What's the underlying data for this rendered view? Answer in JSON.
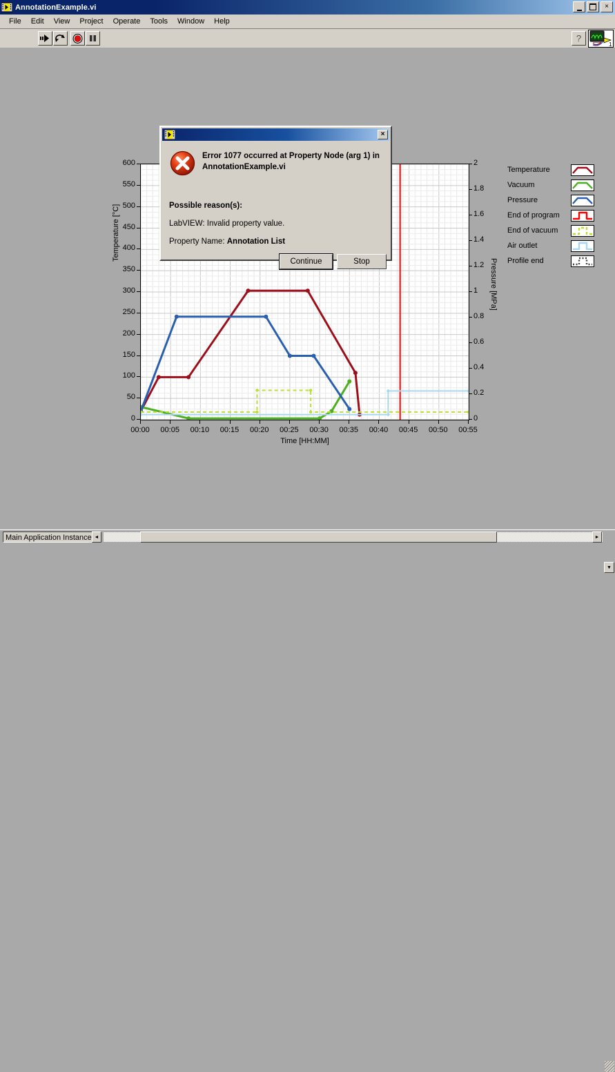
{
  "window": {
    "title": "AnnotationExample.vi",
    "icon": "labview-vi-icon",
    "minimize": "_",
    "maximize": "□",
    "close": "×"
  },
  "menu": {
    "items": [
      {
        "label": "File"
      },
      {
        "label": "Edit"
      },
      {
        "label": "View"
      },
      {
        "label": "Project"
      },
      {
        "label": "Operate"
      },
      {
        "label": "Tools"
      },
      {
        "label": "Window"
      },
      {
        "label": "Help"
      }
    ]
  },
  "toolbar": {
    "run_label": "run-arrow-icon",
    "run_continuous_label": "run-continuously-icon",
    "abort_label": "abort-execution-icon",
    "pause_label": "pause-icon",
    "help_label": "?",
    "vi_icon_label": "vi-connector-pane",
    "vi_icon_number": "1"
  },
  "dialog": {
    "title": "",
    "close_label": "×",
    "error_title": "Error 1077 occurred at Property Node (arg 1) in AnnotationExample.vi",
    "reason_heading": "Possible reason(s):",
    "reason_line": "LabVIEW:  Invalid property value.",
    "property_label": "Property Name: ",
    "property_value": "Annotation List",
    "continue_label": "Continue",
    "stop_label": "Stop",
    "icon": "error-x-icon"
  },
  "graph": {
    "left_axis_title": "Temperature [°C]",
    "right_axis_title": "Pressure [MPa]",
    "x_axis_title": "Time [HH:MM]"
  },
  "legend": {
    "items": [
      {
        "label": "Temperature",
        "color": "#9c0f1a",
        "style": "solid",
        "swatch": "ramp"
      },
      {
        "label": "Vacuum",
        "color": "#4caf20",
        "style": "solid",
        "swatch": "ramp"
      },
      {
        "label": "Pressure",
        "color": "#2a5fb0",
        "style": "solid",
        "swatch": "ramp"
      },
      {
        "label": "End of program",
        "color": "#ff0000",
        "style": "solid",
        "swatch": "step"
      },
      {
        "label": "End of vacuum",
        "color": "#bbe030",
        "style": "dashed",
        "swatch": "step"
      },
      {
        "label": "Air outlet",
        "color": "#a8d8f0",
        "style": "solid",
        "swatch": "step"
      },
      {
        "label": "Profile end",
        "color": "#404040",
        "style": "dotted",
        "swatch": "step"
      }
    ]
  },
  "statusbar": {
    "context": "Main Application Instance",
    "left_arrow": "◄",
    "right_arrow": "►",
    "up_arrow": "▼"
  },
  "chart_data": {
    "type": "line",
    "title": "",
    "xlabel": "Time [HH:MM]",
    "ylabel": "Temperature [°C]",
    "ylabel_right": "Pressure [MPa]",
    "xlim": [
      0,
      55
    ],
    "ylim": [
      0,
      600
    ],
    "ylim_right": [
      0,
      2
    ],
    "grid": true,
    "legend_position": "right-outside",
    "xticks": [
      "00:00",
      "00:05",
      "00:10",
      "00:15",
      "00:20",
      "00:25",
      "00:30",
      "00:35",
      "00:40",
      "00:45",
      "00:50",
      "00:55"
    ],
    "xtick_values": [
      0,
      5,
      10,
      15,
      20,
      25,
      30,
      35,
      40,
      45,
      50,
      55
    ],
    "yticks_left": [
      0,
      50,
      100,
      150,
      200,
      250,
      300,
      350,
      400,
      450,
      500,
      550,
      600
    ],
    "yticks_right": [
      0,
      0.2,
      0.4,
      0.6,
      0.8,
      1,
      1.2,
      1.4,
      1.6,
      1.8,
      2
    ],
    "series": [
      {
        "name": "Temperature",
        "color": "#9c0f1a",
        "axis": "left",
        "style": "solid",
        "width": 3,
        "markers": true,
        "points": [
          [
            0,
            20
          ],
          [
            3,
            100
          ],
          [
            8,
            100
          ],
          [
            18,
            303
          ],
          [
            28,
            303
          ],
          [
            36,
            110
          ],
          [
            36.7,
            12
          ]
        ]
      },
      {
        "name": "Vacuum",
        "color": "#4caf20",
        "axis": "left",
        "style": "solid",
        "width": 3,
        "markers": true,
        "points": [
          [
            0,
            30
          ],
          [
            8,
            3
          ],
          [
            30,
            3
          ],
          [
            32,
            20
          ],
          [
            35,
            90
          ]
        ]
      },
      {
        "name": "Pressure",
        "color": "#2a5fb0",
        "axis": "left",
        "style": "solid",
        "width": 3,
        "markers": true,
        "points": [
          [
            0,
            20
          ],
          [
            6,
            242
          ],
          [
            21,
            242
          ],
          [
            25,
            150
          ],
          [
            29,
            150
          ],
          [
            35,
            25
          ]
        ]
      },
      {
        "name": "End of program",
        "color": "#ff0000",
        "axis": "right",
        "style": "solid",
        "width": 2,
        "markers": false,
        "points": [
          [
            43.5,
            0
          ],
          [
            43.5,
            2
          ]
        ]
      },
      {
        "name": "End of vacuum",
        "color": "#bbe030",
        "axis": "right",
        "style": "dashed",
        "width": 2,
        "markers": true,
        "points": [
          [
            0,
            0.06
          ],
          [
            19.5,
            0.06
          ],
          [
            19.5,
            0.23
          ],
          [
            28.5,
            0.23
          ],
          [
            28.5,
            0.06
          ],
          [
            55,
            0.06
          ]
        ]
      },
      {
        "name": "Air outlet",
        "color": "#a8d8f0",
        "axis": "right",
        "style": "solid",
        "width": 2,
        "markers": true,
        "points": [
          [
            0,
            0.04
          ],
          [
            41.5,
            0.04
          ],
          [
            41.5,
            0.225
          ],
          [
            55,
            0.225
          ]
        ]
      }
    ]
  }
}
